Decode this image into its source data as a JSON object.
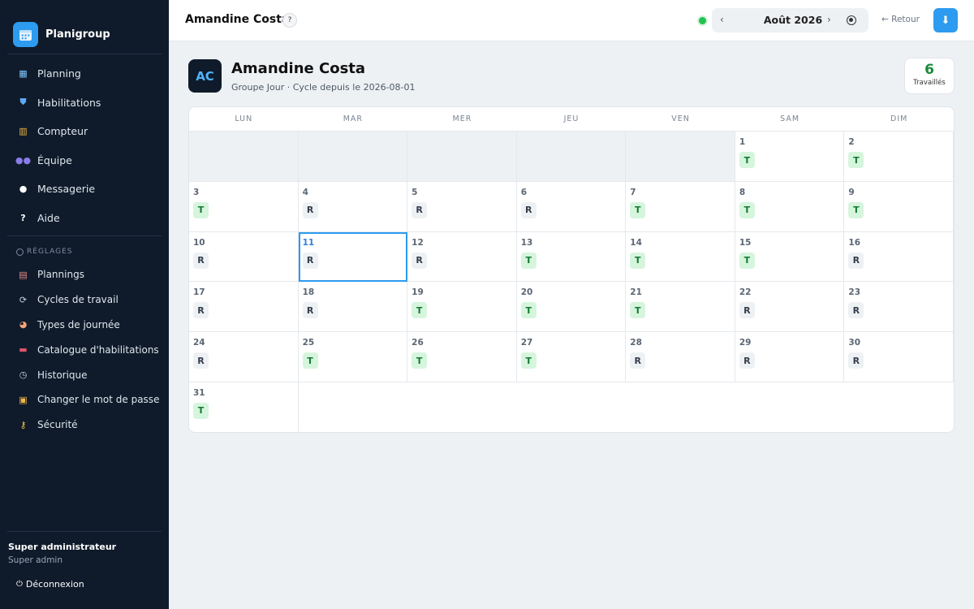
{
  "app": {
    "name": "Planigroup"
  },
  "sidebar": {
    "nav": [
      {
        "label": "Planning",
        "icon": "calendar-icon"
      },
      {
        "label": "Habilitations",
        "icon": "shield-icon"
      },
      {
        "label": "Compteur",
        "icon": "chart-icon"
      },
      {
        "label": "Équipe",
        "icon": "team-icon"
      },
      {
        "label": "Messagerie",
        "icon": "chat-icon"
      },
      {
        "label": "Aide",
        "icon": "question-icon"
      }
    ],
    "settings_title": "RÉGLAGES",
    "settings": [
      {
        "label": "Plannings",
        "icon": "document-icon"
      },
      {
        "label": "Cycles de travail",
        "icon": "cycle-icon"
      },
      {
        "label": "Types de journée",
        "icon": "palette-icon"
      },
      {
        "label": "Catalogue d'habilitations",
        "icon": "toolbox-icon"
      },
      {
        "label": "Historique",
        "icon": "clock-icon"
      },
      {
        "label": "Changer le mot de passe",
        "icon": "lock-icon"
      },
      {
        "label": "Sécurité",
        "icon": "key-icon"
      }
    ],
    "user": {
      "role": "Super administrateur",
      "sub": "Super admin"
    },
    "logout_label": "Déconnexion"
  },
  "topbar": {
    "title": "Amandine Costa",
    "help": "?",
    "month": "Août 2026",
    "prev": "‹",
    "next": "›",
    "back_label": "← Retour",
    "download_icon": "download-icon"
  },
  "employee": {
    "initials": "AC",
    "name": "Amandine Costa",
    "subtitle": "Groupe Jour · Cycle depuis le 2026-08-01",
    "worked_count": "6",
    "worked_label": "Travaillés"
  },
  "calendar": {
    "weekdays": [
      "LUN",
      "MAR",
      "MER",
      "JEU",
      "VEN",
      "SAM",
      "DIM"
    ],
    "leading_empty": 5,
    "today": 11,
    "days": [
      {
        "d": "1",
        "code": "T"
      },
      {
        "d": "2",
        "code": "T"
      },
      {
        "d": "3",
        "code": "T"
      },
      {
        "d": "4",
        "code": "R"
      },
      {
        "d": "5",
        "code": "R"
      },
      {
        "d": "6",
        "code": "R"
      },
      {
        "d": "7",
        "code": "T"
      },
      {
        "d": "8",
        "code": "T"
      },
      {
        "d": "9",
        "code": "T"
      },
      {
        "d": "10",
        "code": "R"
      },
      {
        "d": "11",
        "code": "R"
      },
      {
        "d": "12",
        "code": "R"
      },
      {
        "d": "13",
        "code": "T"
      },
      {
        "d": "14",
        "code": "T"
      },
      {
        "d": "15",
        "code": "T"
      },
      {
        "d": "16",
        "code": "R"
      },
      {
        "d": "17",
        "code": "R"
      },
      {
        "d": "18",
        "code": "R"
      },
      {
        "d": "19",
        "code": "T"
      },
      {
        "d": "20",
        "code": "T"
      },
      {
        "d": "21",
        "code": "T"
      },
      {
        "d": "22",
        "code": "R"
      },
      {
        "d": "23",
        "code": "R"
      },
      {
        "d": "24",
        "code": "R"
      },
      {
        "d": "25",
        "code": "T"
      },
      {
        "d": "26",
        "code": "T"
      },
      {
        "d": "27",
        "code": "T"
      },
      {
        "d": "28",
        "code": "R"
      },
      {
        "d": "29",
        "code": "R"
      },
      {
        "d": "30",
        "code": "R"
      },
      {
        "d": "31",
        "code": "T"
      }
    ]
  },
  "colors": {
    "accent": "#2d9bef",
    "sidebar": "#0f1b2a",
    "worked": "#1b8a3a"
  }
}
